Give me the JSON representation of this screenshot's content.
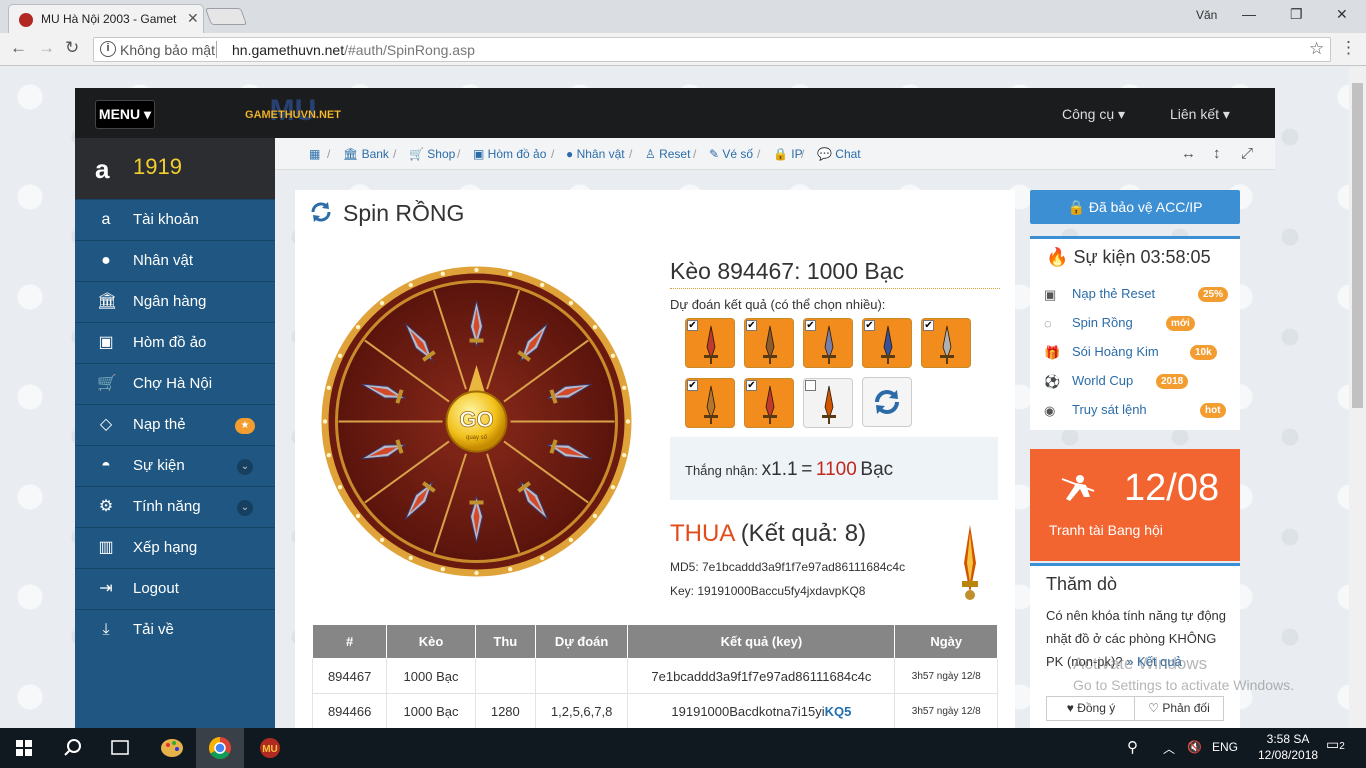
{
  "browser": {
    "tab_title": "MU Hà Nội 2003 - Gamet",
    "user": "Văn",
    "security_label": "Không bảo mật",
    "url_host": "hn.gamethuvn.net",
    "url_path": "/#auth/SpinRong.asp"
  },
  "topbar": {
    "menu_label": "MENU",
    "logo_text": "GAMETHUVN.NET",
    "tools_label": "Công cụ",
    "links_label": "Liên kết"
  },
  "sidebar": {
    "coin_value": "1919",
    "items": [
      {
        "label": "Tài khoản",
        "icon": "amazon-icon"
      },
      {
        "label": "Nhân vật",
        "icon": "user-icon"
      },
      {
        "label": "Ngân hàng",
        "icon": "bank-icon"
      },
      {
        "label": "Hòm đồ ảo",
        "icon": "briefcase-icon"
      },
      {
        "label": "Chợ Hà Nội",
        "icon": "cart-icon"
      },
      {
        "label": "Nạp thẻ",
        "icon": "diamond-icon",
        "badge": "★"
      },
      {
        "label": "Sự kiện",
        "icon": "android-icon"
      },
      {
        "label": "Tính năng",
        "icon": "cogs-icon"
      },
      {
        "label": "Xếp hạng",
        "icon": "bar-chart-icon"
      },
      {
        "label": "Logout",
        "icon": "sign-out-icon"
      },
      {
        "label": "Tải về",
        "icon": "download-icon"
      }
    ]
  },
  "breadcrumb": [
    "Bank",
    "Shop",
    "Hòm đồ ảo",
    "Nhân vật",
    "Reset",
    "Vé số",
    "IP",
    "Chat"
  ],
  "main": {
    "title": "Spin RỒNG",
    "go_label": "GO",
    "go_sub": "quay số",
    "keo_title": "Kèo 894467: 1000 Bạc",
    "predict_label": "Dự đoán kết quả (có thể chọn nhiều):",
    "picks": [
      true,
      true,
      true,
      true,
      true,
      true,
      true,
      false
    ],
    "win_label": "Thắng nhận:",
    "win_multiplier": "x1.1",
    "win_equals": "=",
    "win_amount": "1100",
    "win_unit": "Bạc",
    "result_status": "THUA",
    "result_detail": "(Kết quả: 8)",
    "md5": "MD5: 7e1bcaddd3a9f1f7e97ad86111684c4c",
    "key": "Key: 19191000Baccu5fy4jxdavpKQ8",
    "table": {
      "headers": [
        "#",
        "Kèo",
        "Thu",
        "Dự đoán",
        "Kết quả (key)",
        "Ngày"
      ],
      "rows": [
        {
          "id": "894467",
          "keo": "1000 Bạc",
          "thu": "",
          "dudoan": "",
          "ketqua": "7e1bcaddd3a9f1f7e97ad86111684c4c",
          "ketqua_hl": "",
          "ngay": "3h57 ngày 12/8"
        },
        {
          "id": "894466",
          "keo": "1000 Bạc",
          "thu": "1280",
          "dudoan": "1,2,5,6,7,8",
          "ketqua": "19191000Bacdkotna7i15yi",
          "ketqua_hl": "KQ5",
          "ngay": "3h57 ngày 12/8"
        }
      ]
    }
  },
  "right": {
    "protect_label": "Đã bảo vệ ACC/IP",
    "event_title": "Sự kiện 03:58:05",
    "events": [
      {
        "label": "Nạp thẻ Reset",
        "badge": "25%"
      },
      {
        "label": "Spin Rồng",
        "badge": "mới"
      },
      {
        "label": "Sói Hoàng Kim",
        "badge": "10k"
      },
      {
        "label": "World Cup",
        "badge": "2018"
      },
      {
        "label": "Truy sát lệnh",
        "badge": "hot"
      }
    ],
    "promo_date": "12/08",
    "promo_caption": "Tranh tài Bang hội",
    "poll_title": "Thăm dò",
    "poll_question": "Có nên khóa tính năng tự động nhặt đồ ở các phòng KHÔNG PK (non-pk)?",
    "poll_link": "» Kết quả",
    "poll_agree": "Đồng ý",
    "poll_disagree": "Phản đối"
  },
  "watermark": {
    "line1": "Activate Windows",
    "line2": "Go to Settings to activate Windows."
  },
  "taskbar": {
    "lang": "ENG",
    "time": "3:58 SA",
    "date": "12/08/2018",
    "notif": "2"
  }
}
